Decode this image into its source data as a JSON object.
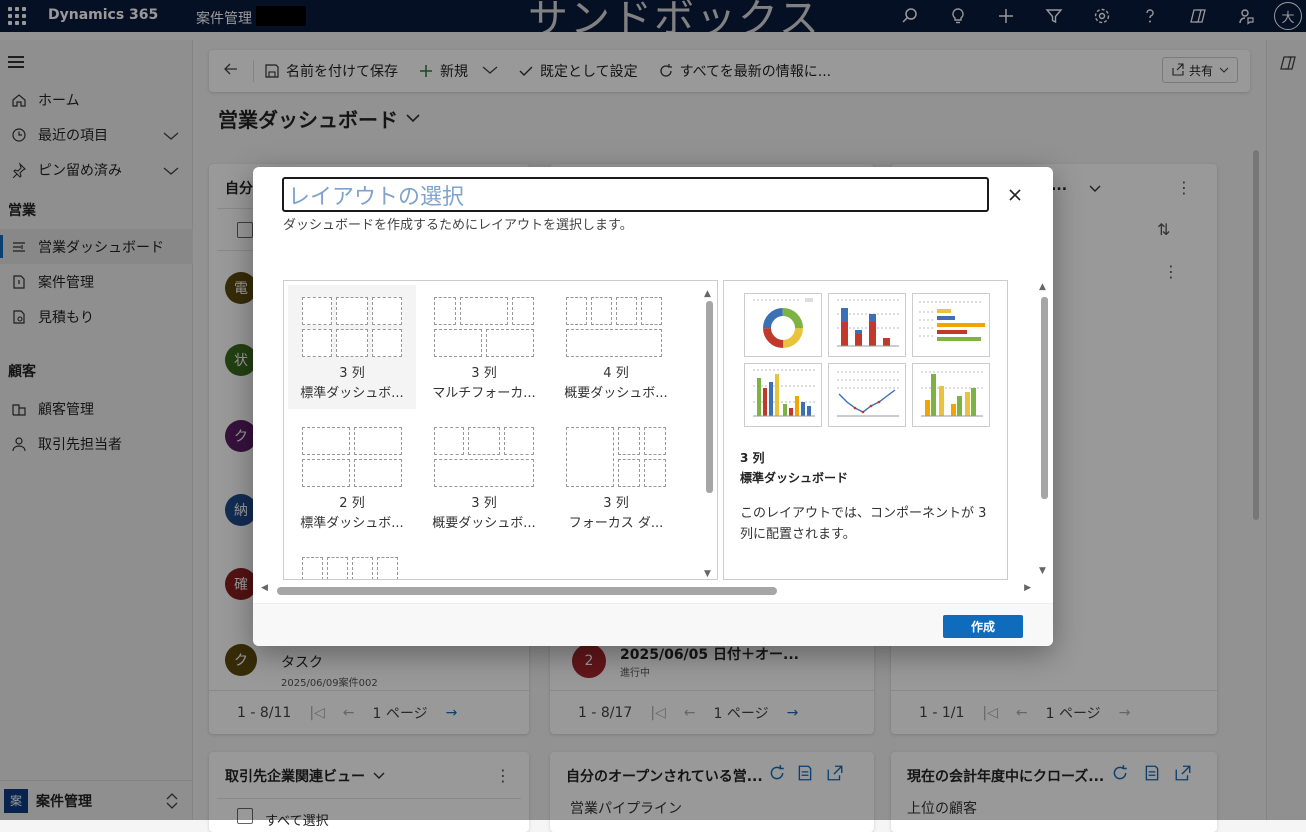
{
  "topbar": {
    "app_name": "Dynamics 365",
    "module": "案件管理",
    "environment_banner": "サンドボックス",
    "user_initial": "大",
    "icons": [
      "search-icon",
      "lightbulb-icon",
      "plus-icon",
      "filter-icon",
      "settings-icon",
      "help-icon",
      "copilot-icon",
      "feedback-icon"
    ]
  },
  "sidebar": {
    "top_items": [
      {
        "label": "ホーム",
        "icon": "home-icon"
      },
      {
        "label": "最近の項目",
        "icon": "clock-icon"
      },
      {
        "label": "ピン留め済み",
        "icon": "pin-icon"
      }
    ],
    "section_sales": "営業",
    "sales_items": [
      {
        "label": "営業ダッシュボード",
        "icon": "dashboard-icon",
        "active": true
      },
      {
        "label": "案件管理",
        "icon": "document-icon"
      },
      {
        "label": "見積もり",
        "icon": "quote-icon"
      }
    ],
    "section_customers": "顧客",
    "customer_items": [
      {
        "label": "顧客管理",
        "icon": "building-icon"
      },
      {
        "label": "取引先担当者",
        "icon": "person-icon"
      }
    ],
    "area_badge": "案",
    "area_label": "案件管理"
  },
  "commandbar": {
    "save_as": "名前を付けて保存",
    "new": "新規",
    "set_default": "既定として設定",
    "refresh_all": "すべてを最新の情報に...",
    "share": "共有"
  },
  "dashboard": {
    "title": "営業ダッシュボード",
    "card1": {
      "title_partial": "自分",
      "avatars": [
        {
          "initial": "電",
          "color": "#5c4a0e"
        },
        {
          "initial": "状",
          "color": "#3a6b1f"
        },
        {
          "initial": "ク",
          "color": "#5b1f66"
        },
        {
          "initial": "納",
          "color": "#1f4a8a"
        },
        {
          "initial": "確",
          "color": "#8a1f1f"
        },
        {
          "initial": "ク",
          "color": "#5c4a0e"
        }
      ],
      "last_row_title": "タスク",
      "last_row_sub": "2025/06/09案件002",
      "pager_range": "1 - 8/11",
      "pager_page": "1 ページ"
    },
    "card2": {
      "row_badge": "2",
      "row_title": "2025/06/05 日付＋オー...",
      "row_sub": "進行中",
      "pager_range": "1 - 8/17",
      "pager_page": "1 ページ"
    },
    "card3": {
      "title_partial": "S...",
      "pager_range": "1 - 1/1",
      "pager_page": "1 ページ"
    },
    "card4": {
      "title": "取引先企業関連ビュー",
      "select_all": "すべて選択"
    },
    "card5": {
      "title": "自分のオープンされている営...",
      "subtitle": "営業パイプライン"
    },
    "card6": {
      "title": "現在の会計年度中にクローズ...",
      "subtitle": "上位の顧客"
    }
  },
  "dialog": {
    "title": "レイアウトの選択",
    "subtitle": "ダッシュボードを作成するためにレイアウトを選択します。",
    "options": [
      {
        "line1": "3 列",
        "line2": "標準ダッシュボ..."
      },
      {
        "line1": "3 列",
        "line2": "マルチフォーカ..."
      },
      {
        "line1": "4 列",
        "line2": "概要ダッシュボ..."
      },
      {
        "line1": "2 列",
        "line2": "標準ダッシュボ..."
      },
      {
        "line1": "3 列",
        "line2": "概要ダッシュボ..."
      },
      {
        "line1": "3 列",
        "line2": "フォーカス ダ..."
      }
    ],
    "preview_line1": "3 列",
    "preview_line2": "標準ダッシュボード",
    "preview_desc": "このレイアウトでは、コンポーネントが 3 列に配置されます。",
    "create_button": "作成"
  },
  "colors": {
    "topbar": "#0b1c3e",
    "accent": "#0f6cbd"
  }
}
